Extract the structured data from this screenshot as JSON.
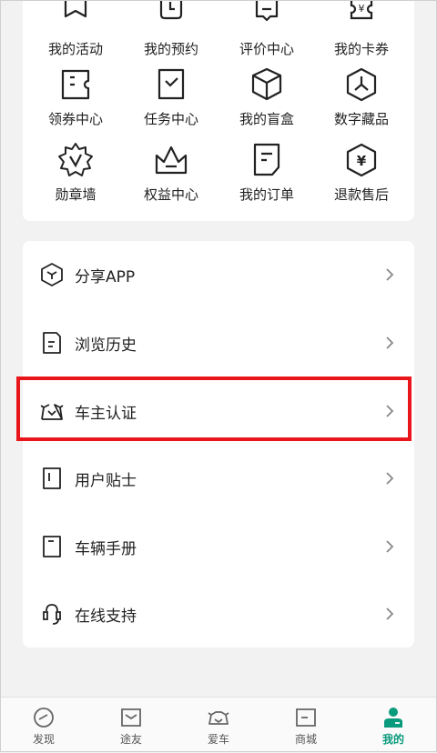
{
  "grid": {
    "items": [
      {
        "label": "我的活动",
        "icon": "activity-flag-icon"
      },
      {
        "label": "我的预约",
        "icon": "appointment-clock-icon"
      },
      {
        "label": "评价中心",
        "icon": "review-bubble-icon"
      },
      {
        "label": "我的卡券",
        "icon": "card-voucher-icon"
      },
      {
        "label": "领券中心",
        "icon": "coupon-ticket-icon"
      },
      {
        "label": "任务中心",
        "icon": "task-check-icon"
      },
      {
        "label": "我的盲盒",
        "icon": "blind-box-icon"
      },
      {
        "label": "数字藏品",
        "icon": "digital-collectible-icon"
      },
      {
        "label": "勋章墙",
        "icon": "medal-icon"
      },
      {
        "label": "权益中心",
        "icon": "crown-icon"
      },
      {
        "label": "我的订单",
        "icon": "order-document-icon"
      },
      {
        "label": "退款售后",
        "icon": "refund-yen-icon"
      }
    ]
  },
  "list": {
    "items": [
      {
        "label": "分享APP",
        "icon": "share-hexagon-icon"
      },
      {
        "label": "浏览历史",
        "icon": "history-document-icon"
      },
      {
        "label": "车主认证",
        "icon": "owner-certification-icon"
      },
      {
        "label": "用户贴士",
        "icon": "user-tips-icon"
      },
      {
        "label": "车辆手册",
        "icon": "vehicle-manual-icon"
      },
      {
        "label": "在线支持",
        "icon": "online-support-headset-icon"
      }
    ]
  },
  "nav": {
    "items": [
      {
        "label": "发现",
        "icon": "discover-compass-icon"
      },
      {
        "label": "途友",
        "icon": "friends-message-icon"
      },
      {
        "label": "爱车",
        "icon": "car-icon"
      },
      {
        "label": "商城",
        "icon": "mall-icon"
      },
      {
        "label": "我的",
        "icon": "profile-person-icon"
      }
    ],
    "active": "我的"
  },
  "colors": {
    "accent": "#0a9a7c",
    "highlight": "#e8161b"
  }
}
